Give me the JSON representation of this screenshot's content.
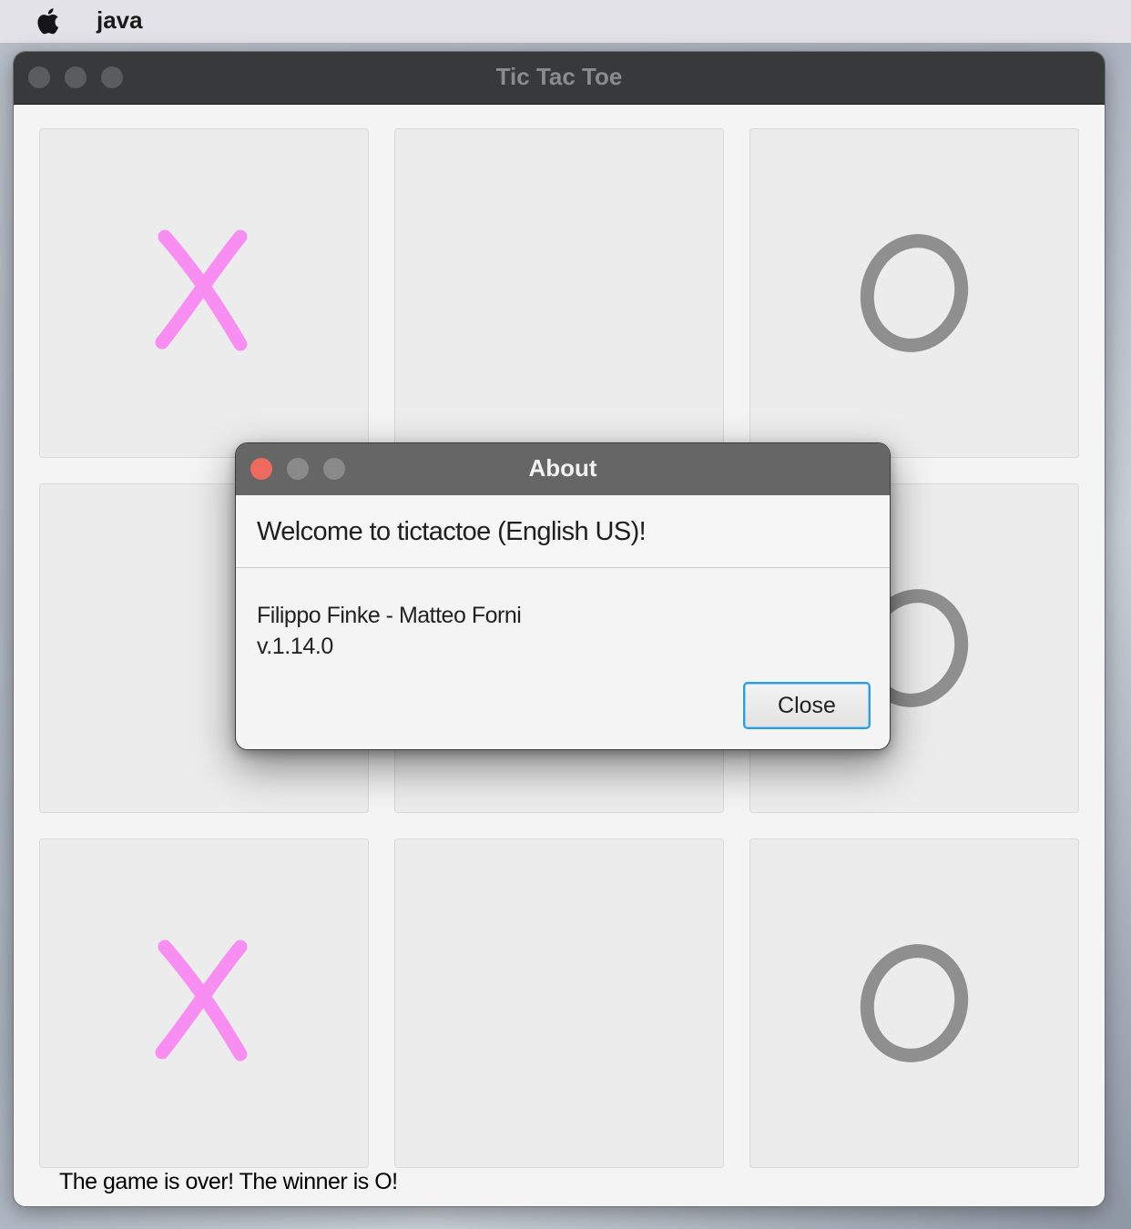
{
  "menubar": {
    "app_name": "java",
    "apple_icon": "apple-logo-icon"
  },
  "window": {
    "title": "Tic Tac Toe"
  },
  "board": {
    "cells": [
      "X",
      "",
      "O",
      "",
      "",
      "O",
      "X",
      "",
      "O"
    ],
    "colors": {
      "x": "#f98ef2",
      "o": "#8f8f8f"
    }
  },
  "status": {
    "text": "The game is over! The winner is O!"
  },
  "dialog": {
    "title": "About",
    "header": "Welcome to tictactoe (English US)!",
    "authors": "Filippo Finke - Matteo Forni",
    "version": "v.1.14.0",
    "close_label": "Close"
  }
}
